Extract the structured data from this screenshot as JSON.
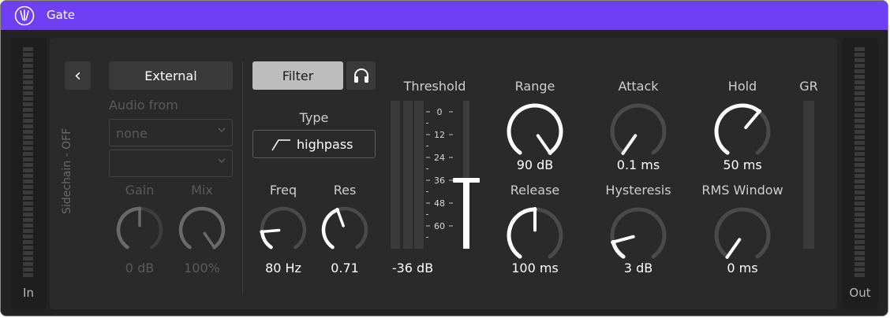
{
  "window": {
    "title": "Gate",
    "accent": "#6e3ff3"
  },
  "meters": {
    "in_label": "In",
    "out_label": "Out"
  },
  "sidechain": {
    "collapse_glyph": "‹",
    "status_label": "Sidechain - OFF",
    "source_button": "External",
    "audio_from_label": "Audio from",
    "audio_from_value": "none",
    "audio_from_channel": "",
    "gain_label": "Gain",
    "gain_value": "0 dB",
    "mix_label": "Mix",
    "mix_value": "100%"
  },
  "filter": {
    "filter_button": "Filter",
    "listen_icon": "headphones-icon",
    "type_label": "Type",
    "type_value": "highpass",
    "freq_label": "Freq",
    "freq_value": "80 Hz",
    "res_label": "Res",
    "res_value": "0.71"
  },
  "threshold": {
    "label": "Threshold",
    "value": "-36 dB",
    "scale": [
      "0",
      "12",
      "24",
      "36",
      "48",
      "60"
    ],
    "level_db": -36
  },
  "knobs": {
    "range_label": "Range",
    "range_value": "90 dB",
    "attack_label": "Attack",
    "attack_value": "0.1 ms",
    "hold_label": "Hold",
    "hold_value": "50 ms",
    "release_label": "Release",
    "release_value": "100 ms",
    "hysteresis_label": "Hysteresis",
    "hysteresis_value": "3 dB",
    "rms_label": "RMS Window",
    "rms_value": "0 ms"
  },
  "gr": {
    "label": "GR"
  }
}
